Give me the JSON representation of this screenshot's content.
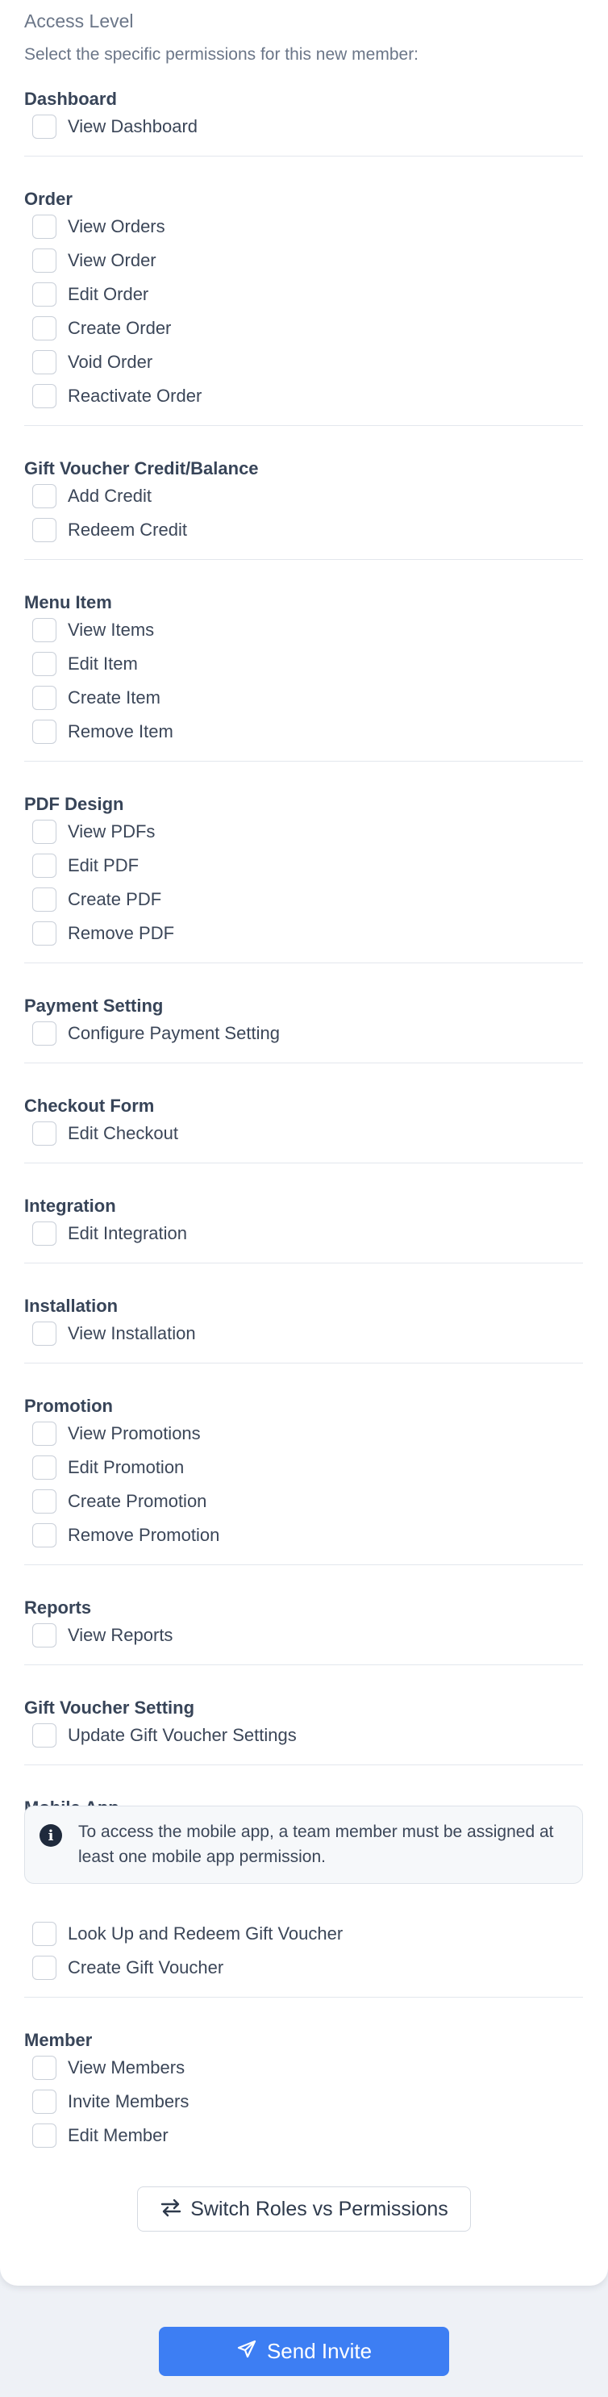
{
  "header": {
    "title": "Access Level",
    "subtitle": "Select the specific permissions for this new member:"
  },
  "sections": [
    {
      "title": "Dashboard",
      "items": [
        "View Dashboard"
      ]
    },
    {
      "title": "Order",
      "items": [
        "View Orders",
        "View Order",
        "Edit Order",
        "Create Order",
        "Void Order",
        "Reactivate Order"
      ]
    },
    {
      "title": "Gift Voucher Credit/Balance",
      "items": [
        "Add Credit",
        "Redeem Credit"
      ]
    },
    {
      "title": "Menu Item",
      "items": [
        "View Items",
        "Edit Item",
        "Create Item",
        "Remove Item"
      ]
    },
    {
      "title": "PDF Design",
      "items": [
        "View PDFs",
        "Edit PDF",
        "Create PDF",
        "Remove PDF"
      ]
    },
    {
      "title": "Payment Setting",
      "items": [
        "Configure Payment Setting"
      ]
    },
    {
      "title": "Checkout Form",
      "items": [
        "Edit Checkout"
      ]
    },
    {
      "title": "Integration",
      "items": [
        "Edit Integration"
      ]
    },
    {
      "title": "Installation",
      "items": [
        "View Installation"
      ]
    },
    {
      "title": "Promotion",
      "items": [
        "View Promotions",
        "Edit Promotion",
        "Create Promotion",
        "Remove Promotion"
      ]
    },
    {
      "title": "Reports",
      "items": [
        "View Reports"
      ]
    },
    {
      "title": "Gift Voucher Setting",
      "items": [
        "Update Gift Voucher Settings"
      ]
    },
    {
      "title": "Mobile App",
      "items": [
        "Look Up and Redeem Gift Voucher",
        "Create Gift Voucher"
      ],
      "info": "To access the mobile app, a team member must be assigned at least one mobile app permission."
    },
    {
      "title": "Member",
      "items": [
        "View Members",
        "Invite Members",
        "Edit Member"
      ]
    }
  ],
  "switch_button": {
    "label": "Switch Roles vs Permissions",
    "icon": "arrows-swap-icon"
  },
  "send_button": {
    "label": "Send Invite",
    "icon": "paper-plane-icon"
  },
  "colors": {
    "primary": "#3d7ef3",
    "background": "#eef1f6",
    "card": "#ffffff"
  }
}
